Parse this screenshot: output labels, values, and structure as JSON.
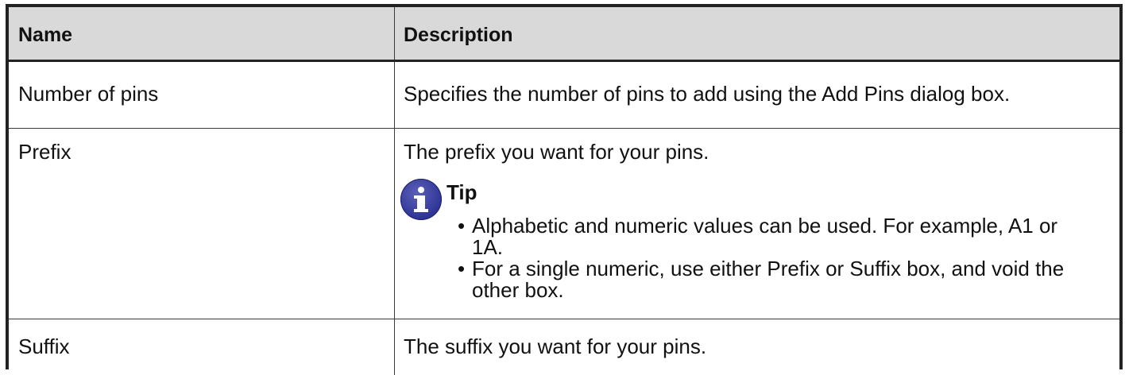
{
  "table": {
    "headers": {
      "name": "Name",
      "description": "Description"
    },
    "rows": [
      {
        "name": "Number of pins",
        "description": "Specifies the number of pins to add using the Add Pins dialog box."
      },
      {
        "name": "Prefix",
        "description": "The prefix you want for your pins.",
        "tip": {
          "icon": "info-icon",
          "title": "Tip",
          "items": [
            "Alphabetic and numeric values can be used. For example, A1 or 1A.",
            "For a single numeric, use either Prefix or Suffix box, and void the other box."
          ]
        }
      },
      {
        "name": "Suffix",
        "description": "The suffix you want for your pins."
      }
    ]
  },
  "colors": {
    "header_bg": "#d9d9d9",
    "border": "#222222",
    "tip_icon": "#2f3596"
  }
}
